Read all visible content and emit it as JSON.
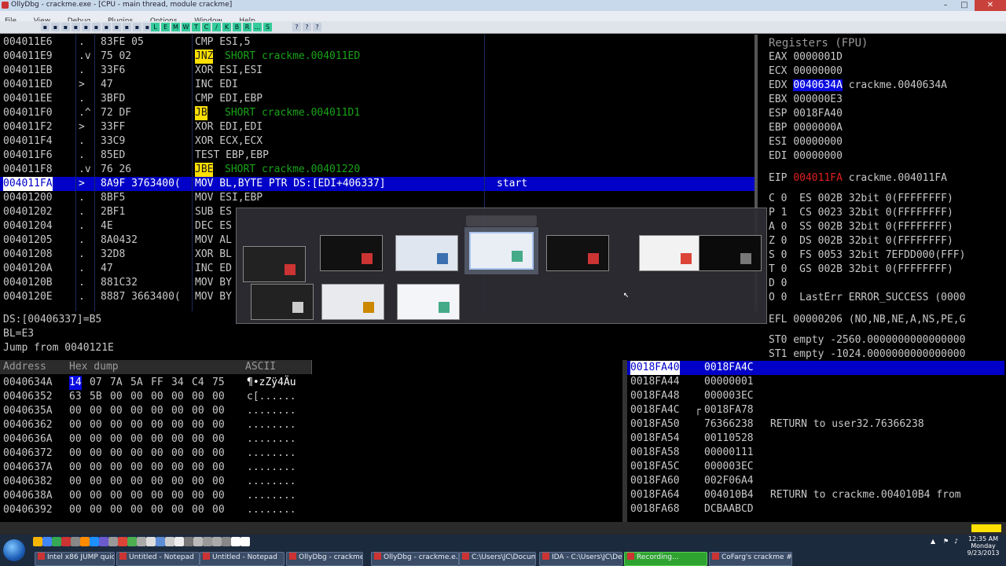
{
  "window": {
    "title": "OllyDbg - crackme.exe - [CPU - main thread, module crackme]",
    "close_glyph": "✕",
    "max_glyph": "□",
    "min_glyph": "–"
  },
  "menu": [
    "File",
    "View",
    "Debug",
    "Plugins",
    "Options",
    "Window",
    "Help"
  ],
  "toolbar": {
    "icons": [
      "open-icon",
      "restart-icon",
      "close-icon",
      "run-icon",
      "pause-icon",
      "step-into-icon",
      "step-over-icon",
      "trace-into-icon",
      "trace-over-icon",
      "execute-till-return-icon",
      "goto-icon"
    ],
    "letters": [
      "L",
      "E",
      "M",
      "W",
      "T",
      "C",
      "/",
      "K",
      "B",
      "R",
      "...",
      "S"
    ]
  },
  "disasm": {
    "rows": [
      {
        "addr": "004011E6",
        "mark": ".",
        "hex": "83FE 05",
        "mn": "CMP ESI,5",
        "cmt": ""
      },
      {
        "addr": "004011E9",
        "mark": ".v",
        "hex": "75 02",
        "mn": "JNZ",
        "arg": "SHORT crackme.004011ED",
        "jump": true,
        "cmt": ""
      },
      {
        "addr": "004011EB",
        "mark": ".",
        "hex": "33F6",
        "mn": "XOR ESI,ESI",
        "cmt": ""
      },
      {
        "addr": "004011ED",
        "mark": ">",
        "hex": "47",
        "mn": "INC EDI",
        "cmt": ""
      },
      {
        "addr": "004011EE",
        "mark": ".",
        "hex": "3BFD",
        "mn": "CMP EDI,EBP",
        "cmt": ""
      },
      {
        "addr": "004011F0",
        "mark": ".^",
        "hex": "72 DF",
        "mn": "JB",
        "arg": "SHORT crackme.004011D1",
        "jump": true,
        "cmt": ""
      },
      {
        "addr": "004011F2",
        "mark": ">",
        "hex": "33FF",
        "mn": "XOR EDI,EDI",
        "cmt": ""
      },
      {
        "addr": "004011F4",
        "mark": ".",
        "hex": "33C9",
        "mn": "XOR ECX,ECX",
        "cmt": ""
      },
      {
        "addr": "004011F6",
        "mark": ".",
        "hex": "85ED",
        "mn": "TEST EBP,EBP",
        "cmt": ""
      },
      {
        "addr": "004011F8",
        "mark": ".v",
        "hex": "76 26",
        "mn": "JBE",
        "arg": "SHORT crackme.00401220",
        "jump": true,
        "cmt": ""
      },
      {
        "addr": "004011FA",
        "mark": ">",
        "hex": "8A9F 3763400(",
        "mn": "MOV BL,BYTE PTR DS:[EDI+406337]",
        "cmt": "start",
        "selected": true
      },
      {
        "addr": "00401200",
        "mark": ".",
        "hex": "8BF5",
        "mn": "MOV ESI,EBP",
        "cmt": ""
      },
      {
        "addr": "00401202",
        "mark": ".",
        "hex": "2BF1",
        "mn": "SUB ES",
        "cmt": ""
      },
      {
        "addr": "00401204",
        "mark": ".",
        "hex": "4E",
        "mn": "DEC ES",
        "cmt": ""
      },
      {
        "addr": "00401205",
        "mark": ".",
        "hex": "8A0432",
        "mn": "MOV AL",
        "cmt": ""
      },
      {
        "addr": "00401208",
        "mark": ".",
        "hex": "32D8",
        "mn": "XOR BL",
        "cmt": ""
      },
      {
        "addr": "0040120A",
        "mark": ".",
        "hex": "47",
        "mn": "INC ED",
        "cmt": ""
      },
      {
        "addr": "0040120B",
        "mark": ".",
        "hex": "881C32",
        "mn": "MOV BY",
        "cmt": ""
      },
      {
        "addr": "0040120E",
        "mark": ".",
        "hex": "8887 3663400(",
        "mn": "MOV BY",
        "cmt": ""
      }
    ]
  },
  "info": [
    "DS:[00406337]=B5",
    "BL=E3",
    "Jump from 0040121E"
  ],
  "registers": {
    "title": "Registers (FPU)",
    "general": [
      {
        "name": "EAX",
        "val": "0000001D",
        "note": ""
      },
      {
        "name": "ECX",
        "val": "00000000",
        "note": ""
      },
      {
        "name": "EDX",
        "val": "0040634A",
        "note": "crackme.0040634A",
        "sel": true
      },
      {
        "name": "EBX",
        "val": "000000E3",
        "note": ""
      },
      {
        "name": "ESP",
        "val": "0018FA40",
        "note": ""
      },
      {
        "name": "EBP",
        "val": "0000000A",
        "note": ""
      },
      {
        "name": "ESI",
        "val": "00000000",
        "note": ""
      },
      {
        "name": "EDI",
        "val": "00000000",
        "note": ""
      }
    ],
    "eip": {
      "name": "EIP",
      "val": "004011FA",
      "note": "crackme.004011FA"
    },
    "flags": [
      "C 0  ES 002B 32bit 0(FFFFFFFF)",
      "P 1  CS 0023 32bit 0(FFFFFFFF)",
      "A 0  SS 002B 32bit 0(FFFFFFFF)",
      "Z 0  DS 002B 32bit 0(FFFFFFFF)",
      "S 0  FS 0053 32bit 7EFDD000(FFF)",
      "T 0  GS 002B 32bit 0(FFFFFFFF)",
      "D 0",
      "O 0  LastErr ERROR_SUCCESS (0000"
    ],
    "efl": "EFL 00000206 (NO,NB,NE,A,NS,PE,G",
    "st": [
      "ST0 empty -2560.0000000000000000",
      "ST1 empty -1024.0000000000000000"
    ]
  },
  "dump": {
    "headers": [
      "Address",
      "Hex dump",
      "ASCII"
    ],
    "rows": [
      {
        "addr": "0040634A",
        "hex": [
          "14",
          "07",
          "7A",
          "5A",
          "FF",
          "34",
          "C4",
          "75"
        ],
        "ascii": "¶•zZÿ4Äu",
        "first_sel": true
      },
      {
        "addr": "00406352",
        "hex": [
          "63",
          "5B",
          "00",
          "00",
          "00",
          "00",
          "00",
          "00"
        ],
        "ascii": "c[......"
      },
      {
        "addr": "0040635A",
        "hex": [
          "00",
          "00",
          "00",
          "00",
          "00",
          "00",
          "00",
          "00"
        ],
        "ascii": "........"
      },
      {
        "addr": "00406362",
        "hex": [
          "00",
          "00",
          "00",
          "00",
          "00",
          "00",
          "00",
          "00"
        ],
        "ascii": "........"
      },
      {
        "addr": "0040636A",
        "hex": [
          "00",
          "00",
          "00",
          "00",
          "00",
          "00",
          "00",
          "00"
        ],
        "ascii": "........"
      },
      {
        "addr": "00406372",
        "hex": [
          "00",
          "00",
          "00",
          "00",
          "00",
          "00",
          "00",
          "00"
        ],
        "ascii": "........"
      },
      {
        "addr": "0040637A",
        "hex": [
          "00",
          "00",
          "00",
          "00",
          "00",
          "00",
          "00",
          "00"
        ],
        "ascii": "........"
      },
      {
        "addr": "00406382",
        "hex": [
          "00",
          "00",
          "00",
          "00",
          "00",
          "00",
          "00",
          "00"
        ],
        "ascii": "........"
      },
      {
        "addr": "0040638A",
        "hex": [
          "00",
          "00",
          "00",
          "00",
          "00",
          "00",
          "00",
          "00"
        ],
        "ascii": "........"
      },
      {
        "addr": "00406392",
        "hex": [
          "00",
          "00",
          "00",
          "00",
          "00",
          "00",
          "00",
          "00"
        ],
        "ascii": "........"
      }
    ]
  },
  "stack": {
    "rows": [
      {
        "addr": "0018FA40",
        "val": "0018FA4C",
        "cmt": "",
        "sel": true
      },
      {
        "addr": "0018FA44",
        "val": "00000001",
        "cmt": ""
      },
      {
        "addr": "0018FA48",
        "val": "000003EC",
        "cmt": ""
      },
      {
        "addr": "0018FA4C",
        "val": "0018FA78",
        "cmt": "",
        "frame": true
      },
      {
        "addr": "0018FA50",
        "val": "76366238",
        "cmt": "RETURN to user32.76366238"
      },
      {
        "addr": "0018FA54",
        "val": "00110528",
        "cmt": ""
      },
      {
        "addr": "0018FA58",
        "val": "00000111",
        "cmt": ""
      },
      {
        "addr": "0018FA5C",
        "val": "000003EC",
        "cmt": ""
      },
      {
        "addr": "0018FA60",
        "val": "002F06A4",
        "cmt": ""
      },
      {
        "addr": "0018FA64",
        "val": "004010B4",
        "cmt": "RETURN to crackme.004010B4 from"
      },
      {
        "addr": "0018FA68",
        "val": "DCBAABCD",
        "cmt": ""
      }
    ]
  },
  "alttab": {
    "title": "",
    "thumbnails": [
      "OllyDbg window",
      "OllyDbg window",
      "Notepad window",
      "Notepad window (selected)",
      "OllyDbg window",
      "Chrome window",
      "Desktop",
      "Crackme dialog",
      "Notepad window",
      "Explorer window"
    ]
  },
  "taskbar": {
    "buttons": [
      {
        "label": "Intel x86 JUMP quick ..."
      },
      {
        "label": "Untitled - Notepad"
      },
      {
        "label": "Untitled - Notepad"
      },
      {
        "label": "OllyDbg - crackme.e..."
      },
      {
        "label": "OllyDbg - crackme.e..."
      },
      {
        "label": "C:\\Users\\JC\\Docume..."
      },
      {
        "label": "IDA - C:\\Users\\JC\\De..."
      },
      {
        "label": "Recording...",
        "active": true
      },
      {
        "label": "CoFarg's crackme #2"
      }
    ],
    "clock": [
      "12:35 AM",
      "Monday",
      "9/23/2013"
    ]
  }
}
